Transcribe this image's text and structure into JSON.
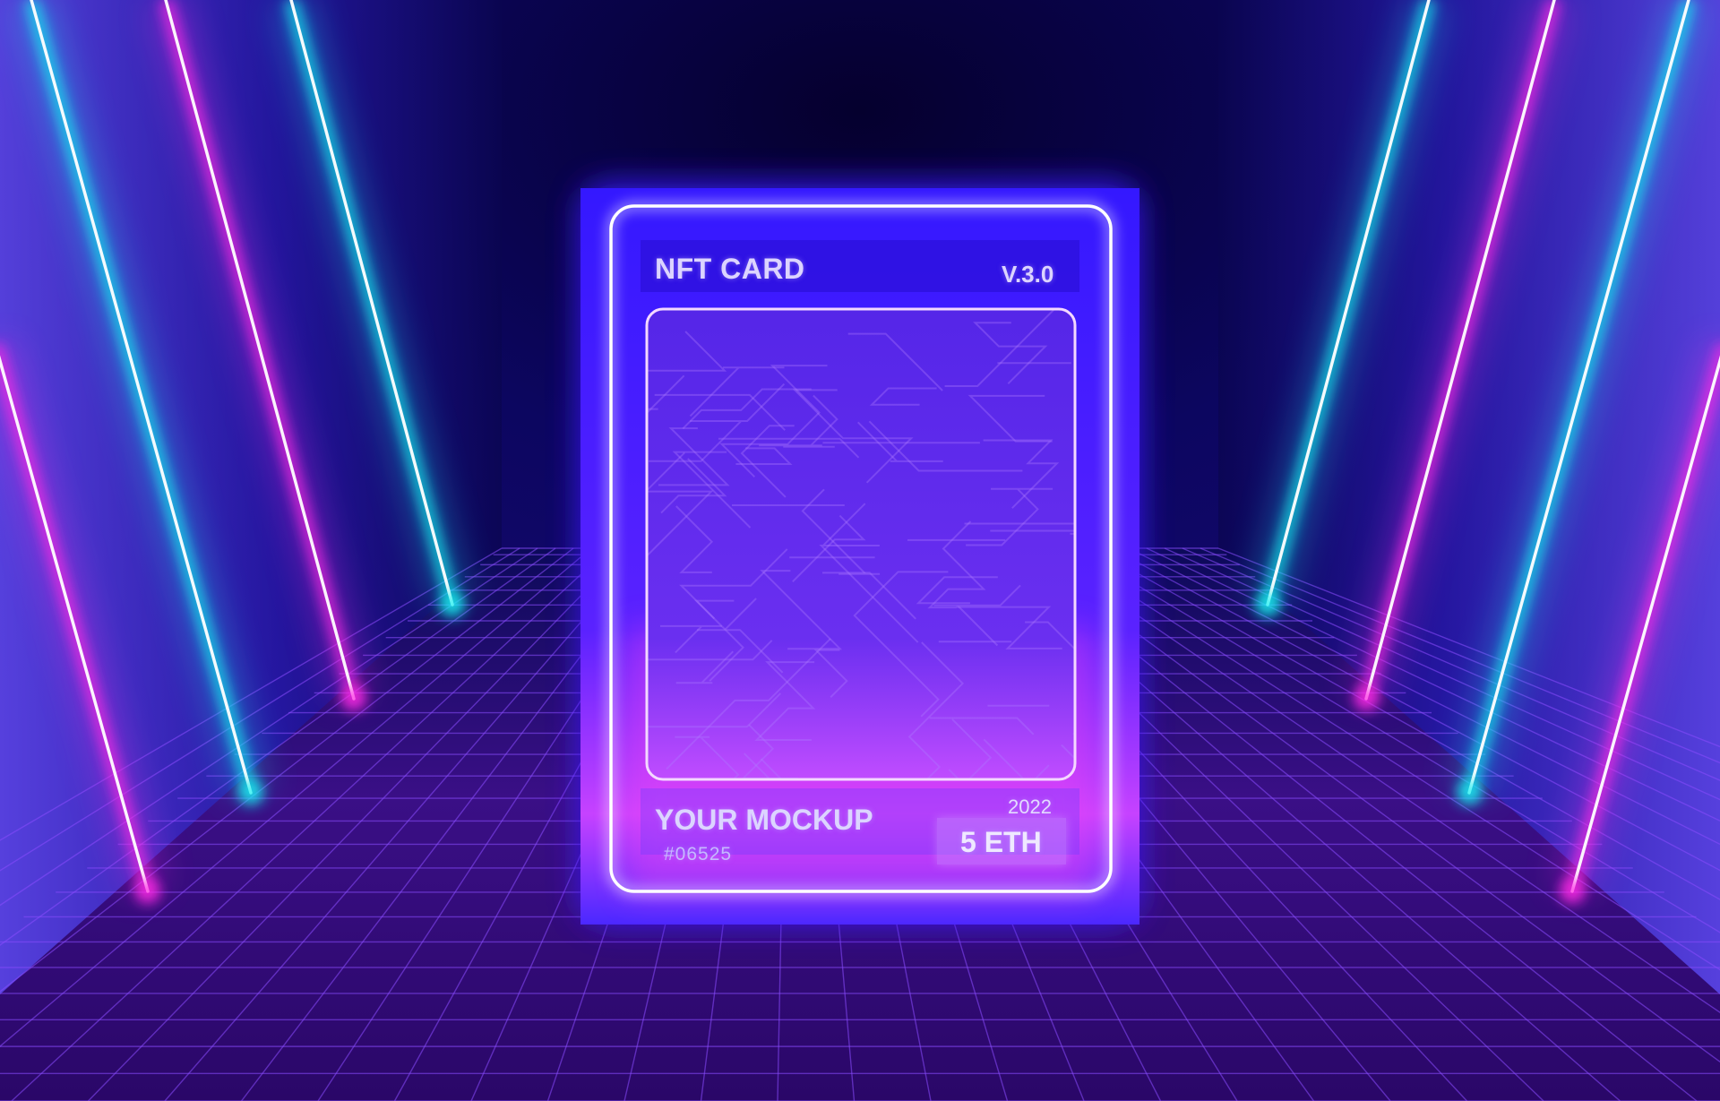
{
  "card": {
    "title": "NFT CARD",
    "version": "V.3.0",
    "name": "YOUR MOCKUP",
    "serial": "#06525",
    "year": "2022",
    "price": "5 ETH"
  },
  "colors": {
    "background": "#060028",
    "neon_cyan": "#18f2f2",
    "neon_magenta": "#ff2ae6",
    "card_blue": "#3a1cff",
    "grid_line": "#8a4cff",
    "frame": "#ffffff"
  }
}
